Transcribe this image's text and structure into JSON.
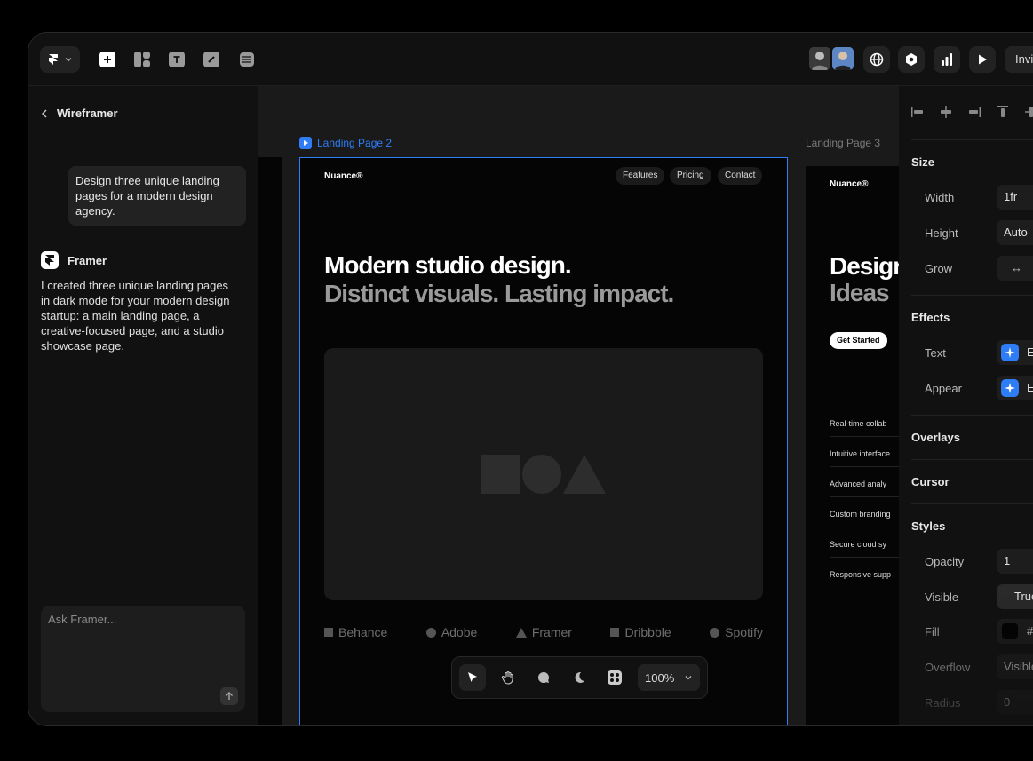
{
  "toolbar": {
    "invite_label": "Invi"
  },
  "left_panel": {
    "back_label": "Wireframer",
    "user_message": "Design three unique landing pages for a modern design agency.",
    "bot_name": "Framer",
    "bot_message": "I created three unique landing pages in dark mode for your modern design startup: a main landing page, a creative-focused page, and a studio showcase page.",
    "ask_placeholder": "Ask Framer..."
  },
  "canvas": {
    "frame_main_label": "Landing Page 2",
    "frame_3_label": "Landing Page 3",
    "frame_main": {
      "brand": "Nuance®",
      "nav": [
        "Features",
        "Pricing",
        "Contact"
      ],
      "hero_line1": "Modern studio design.",
      "hero_line2": "Distinct visuals. Lasting impact.",
      "logos": [
        "Behance",
        "Adobe",
        "Framer",
        "Dribbble",
        "Spotify"
      ]
    },
    "frame_3": {
      "brand": "Nuance®",
      "hero_line1": "Design",
      "hero_line2": "Ideas",
      "cta": "Get Started",
      "features": [
        "Real-time collab",
        "Intuitive interface",
        "Advanced analy",
        "Custom branding",
        "Secure cloud sy",
        "Responsive supp"
      ]
    },
    "zoom": "100%"
  },
  "right_panel": {
    "size_title": "Size",
    "width_label": "Width",
    "width_value": "1fr",
    "height_label": "Height",
    "height_value": "Auto",
    "grow_label": "Grow",
    "grow_value": "↔",
    "effects_title": "Effects",
    "text_label": "Text",
    "text_value": "E",
    "appear_label": "Appear",
    "appear_value": "E",
    "overlays_title": "Overlays",
    "cursor_title": "Cursor",
    "styles_title": "Styles",
    "opacity_label": "Opacity",
    "opacity_value": "1",
    "visible_label": "Visible",
    "visible_value": "True",
    "fill_label": "Fill",
    "fill_value": "#",
    "overflow_label": "Overflow",
    "overflow_value": "Visible",
    "radius_label": "Radius",
    "radius_value": "0"
  },
  "colors": {
    "accent": "#2e7cf6",
    "panel": "#111111",
    "canvas": "#1a1a1a"
  }
}
